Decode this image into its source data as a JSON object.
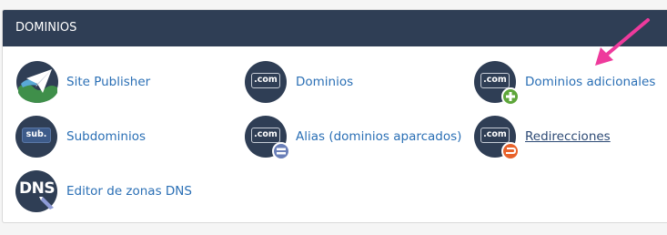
{
  "panel": {
    "title": "DOMINIOS"
  },
  "items": [
    {
      "label": "Site Publisher",
      "icon": "site-publisher-icon"
    },
    {
      "label": "Dominios",
      "icon": "dominios-icon",
      "badge": ".com"
    },
    {
      "label": "Dominios adicionales",
      "icon": "addon-domains-icon",
      "badge": ".com"
    },
    {
      "label": "Subdominios",
      "icon": "subdomains-icon",
      "badge": "sub."
    },
    {
      "label": "Alias (dominios aparcados)",
      "icon": "aliases-icon",
      "badge": ".com"
    },
    {
      "label": "Redirecciones",
      "icon": "redirects-icon",
      "badge": ".com"
    },
    {
      "label": "Editor de zonas DNS",
      "icon": "dns-zone-editor-icon",
      "badge": "DNS"
    }
  ],
  "colors": {
    "header_bg": "#2f3e55",
    "link": "#2a6fb5",
    "plus_badge": "#5ea63a",
    "equals_badge": "#6a7fb8",
    "redirect_badge": "#e8622a",
    "annotation_arrow": "#ee3a9c"
  }
}
